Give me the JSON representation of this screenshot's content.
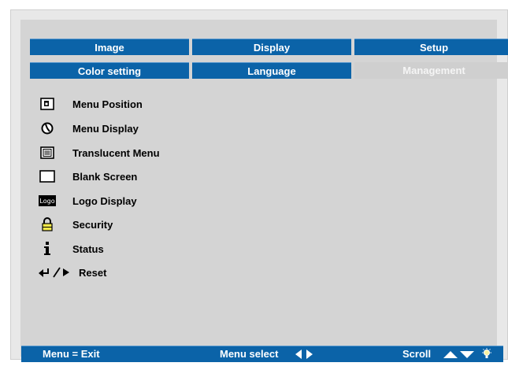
{
  "tabs": {
    "row1": [
      "Image",
      "Display",
      "Setup"
    ],
    "row2": [
      "Color setting",
      "Language",
      "Management"
    ]
  },
  "menu": {
    "items": [
      {
        "label": "Menu Position",
        "icon": "menu-position-icon"
      },
      {
        "label": "Menu Display",
        "icon": "menu-display-icon"
      },
      {
        "label": "Translucent Menu",
        "icon": "translucent-menu-icon"
      },
      {
        "label": "Blank Screen",
        "icon": "blank-screen-icon"
      },
      {
        "label": "Logo Display",
        "icon": "logo-display-icon",
        "icon_text": "Logo"
      },
      {
        "label": "Security",
        "icon": "lock-icon"
      },
      {
        "label": "Status",
        "icon": "info-icon"
      },
      {
        "label": "Reset",
        "icon": "reset-icon"
      }
    ]
  },
  "bottom_bar": {
    "exit": "Menu = Exit",
    "select": "Menu select",
    "scroll": "Scroll"
  },
  "colors": {
    "tab_blue": "#0b63a8",
    "panel_gray": "#d4d4d4",
    "lock_yellow": "#f2e84a"
  }
}
